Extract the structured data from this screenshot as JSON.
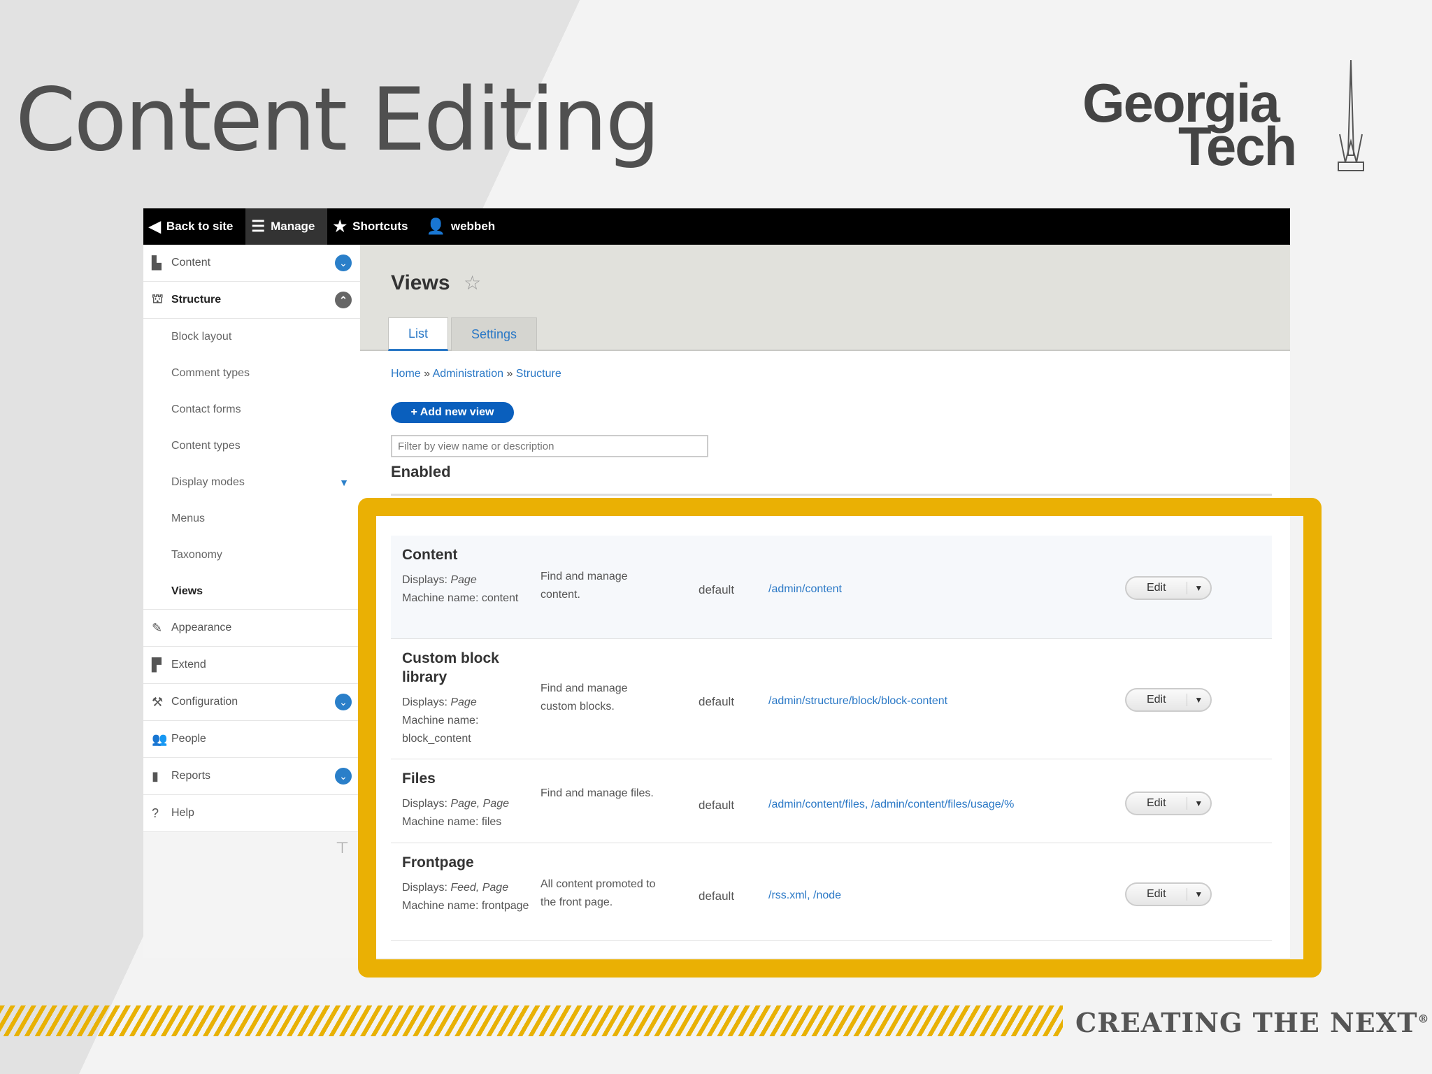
{
  "slide": {
    "title": "Content Editing",
    "logo_line1": "Georgia",
    "logo_line2": "Tech",
    "tagline": "CREATING THE NEXT",
    "tagline_mark": "®",
    "accent_color": "#eab004"
  },
  "toolbar": {
    "back_label": "Back to site",
    "manage_label": "Manage",
    "shortcuts_label": "Shortcuts",
    "user_label": "webbeh"
  },
  "sidebar": {
    "items": [
      {
        "label": "Content",
        "icon": "file-icon"
      },
      {
        "label": "Structure",
        "icon": "sitemap-icon"
      },
      {
        "label": "Block layout"
      },
      {
        "label": "Comment types"
      },
      {
        "label": "Contact forms"
      },
      {
        "label": "Content types"
      },
      {
        "label": "Display modes"
      },
      {
        "label": "Menus"
      },
      {
        "label": "Taxonomy"
      },
      {
        "label": "Views"
      },
      {
        "label": "Appearance",
        "icon": "brush-icon"
      },
      {
        "label": "Extend",
        "icon": "puzzle-icon"
      },
      {
        "label": "Configuration",
        "icon": "wrench-icon"
      },
      {
        "label": "People",
        "icon": "people-icon"
      },
      {
        "label": "Reports",
        "icon": "bar-chart-icon"
      },
      {
        "label": "Help",
        "icon": "help-icon"
      }
    ]
  },
  "page": {
    "title": "Views",
    "tabs": [
      "List",
      "Settings"
    ],
    "breadcrumb": [
      "Home",
      "Administration",
      "Structure"
    ],
    "breadcrumb_sep": "»",
    "add_button": "+ Add new view",
    "filter_placeholder": "Filter by view name or description",
    "section_title": "Enabled"
  },
  "views": [
    {
      "name": "Content",
      "displays_label": "Displays:",
      "displays": "Page",
      "machine": "Machine name: content",
      "description": "Find and manage content.",
      "tag": "default",
      "path": "/admin/content",
      "edit": "Edit"
    },
    {
      "name": "Custom block library",
      "displays_label": "Displays:",
      "displays": "Page",
      "machine": "Machine name: block_content",
      "description": "Find and manage custom blocks.",
      "tag": "default",
      "path": "/admin/structure/block/block-content",
      "edit": "Edit"
    },
    {
      "name": "Files",
      "displays_label": "Displays:",
      "displays": "Page, Page",
      "machine": "Machine name: files",
      "description": "Find and manage files.",
      "tag": "default",
      "path": "/admin/content/files, /admin/content/files/usage/%",
      "edit": "Edit"
    },
    {
      "name": "Frontpage",
      "displays_label": "Displays:",
      "displays": "Feed, Page",
      "machine": "Machine name: frontpage",
      "description": "All content promoted to the front page.",
      "tag": "default",
      "path": "/rss.xml, /node",
      "edit": "Edit"
    }
  ]
}
